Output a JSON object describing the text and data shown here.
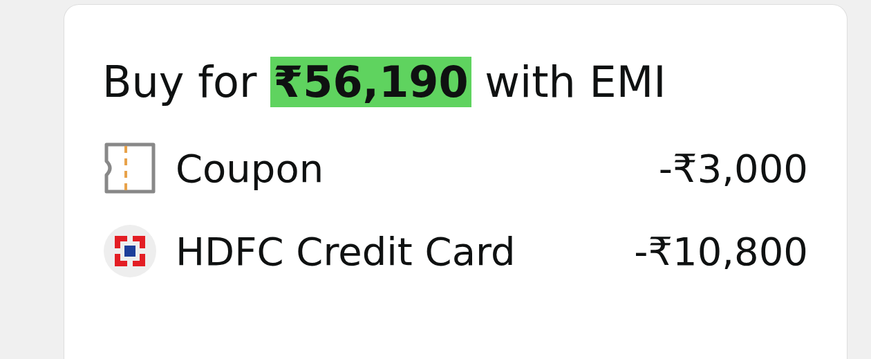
{
  "emi_offer": {
    "title_before": "Buy for",
    "price": "₹56,190",
    "title_after": "with EMI",
    "discounts": [
      {
        "kind": "coupon",
        "label": "Coupon",
        "amount": "-₹3,000"
      },
      {
        "kind": "bank",
        "label": "HDFC Credit Card",
        "amount": "-₹10,800"
      }
    ]
  }
}
